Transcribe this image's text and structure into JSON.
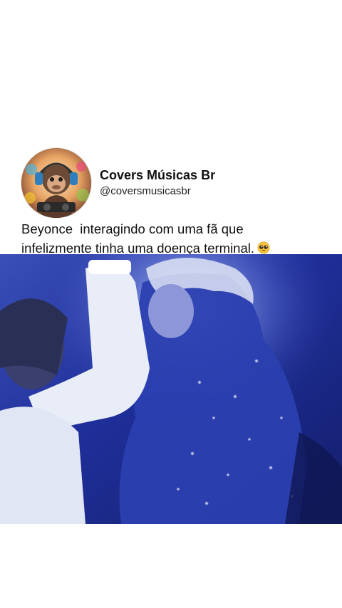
{
  "post": {
    "author": {
      "display_name": "Covers Músicas Br",
      "handle": "@coversmusicasbr",
      "avatar_icon": "monkey-dj-headphones-icon"
    },
    "text_lines": [
      "Beyonce  interagindo com uma fã que",
      "infelizmente tinha uma doença terminal."
    ],
    "emoji": "pleading-face-icon",
    "media": {
      "type": "video-frame"
    }
  },
  "colors": {
    "background": "#ffffff",
    "text": "#111111",
    "media_blue": "#1f2f9a"
  }
}
